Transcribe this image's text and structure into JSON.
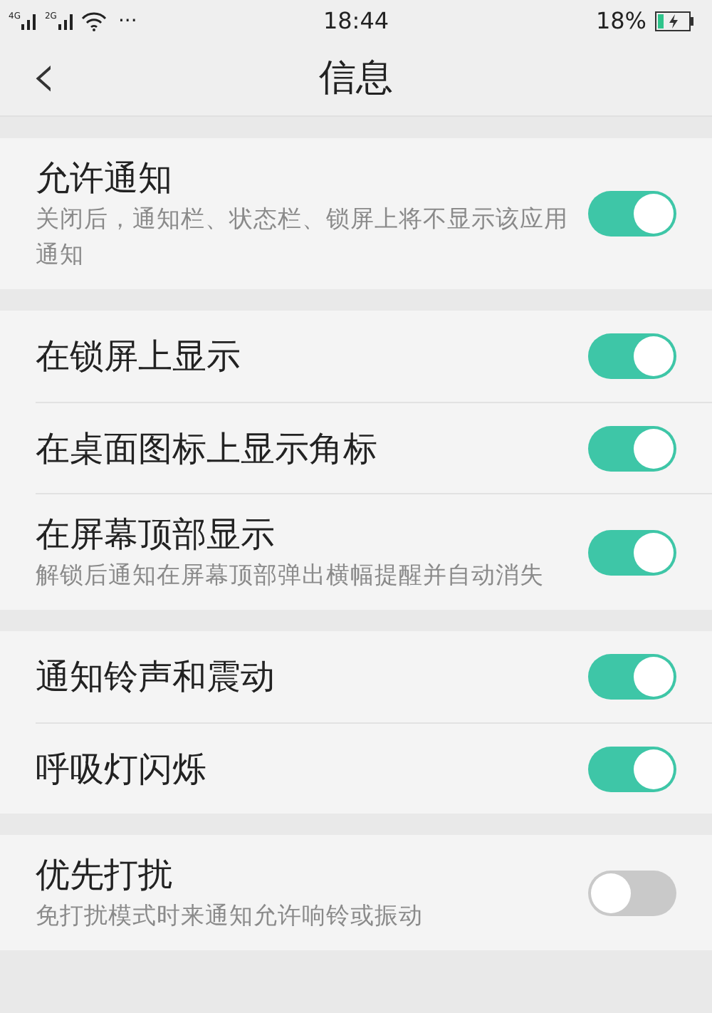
{
  "status_bar": {
    "network_1": "4G",
    "network_2": "2G",
    "more": "···",
    "time": "18:44",
    "battery": "18%"
  },
  "header": {
    "back": "‹",
    "title": "信息"
  },
  "sections": [
    {
      "items": [
        {
          "title": "允许通知",
          "subtitle": "关闭后，通知栏、状态栏、锁屏上将不显示该应用通知",
          "on": true
        }
      ]
    },
    {
      "items": [
        {
          "title": "在锁屏上显示",
          "on": true
        },
        {
          "title": "在桌面图标上显示角标",
          "on": true
        },
        {
          "title": "在屏幕顶部显示",
          "subtitle": "解锁后通知在屏幕顶部弹出横幅提醒并自动消失",
          "on": true
        }
      ]
    },
    {
      "items": [
        {
          "title": "通知铃声和震动",
          "on": true
        },
        {
          "title": "呼吸灯闪烁",
          "on": true
        }
      ]
    },
    {
      "items": [
        {
          "title": "优先打扰",
          "subtitle": "免打扰模式时来通知允许响铃或振动",
          "on": false
        }
      ]
    }
  ]
}
